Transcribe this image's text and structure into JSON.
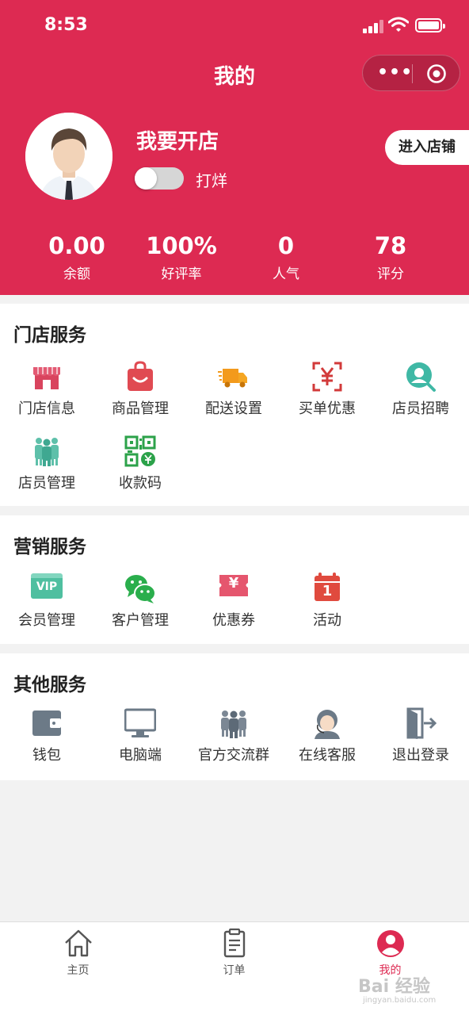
{
  "status_bar": {
    "time": "8:53"
  },
  "header": {
    "title": "我的",
    "capsule_more": "•••",
    "shop_name": "我要开店",
    "toggle_label": "打烊",
    "enter_button": "进入店铺",
    "background_color": "#dd2a52"
  },
  "stats": [
    {
      "value": "0.00",
      "label": "余额"
    },
    {
      "value": "100%",
      "label": "好评率"
    },
    {
      "value": "0",
      "label": "人气"
    },
    {
      "value": "78",
      "label": "评分"
    }
  ],
  "store_services": {
    "title": "门店服务",
    "items": [
      {
        "label": "门店信息",
        "icon": "storefront-icon"
      },
      {
        "label": "商品管理",
        "icon": "shopping-bag-icon"
      },
      {
        "label": "配送设置",
        "icon": "delivery-truck-icon"
      },
      {
        "label": "买单优惠",
        "icon": "scan-yuan-icon"
      },
      {
        "label": "店员招聘",
        "icon": "search-person-icon"
      },
      {
        "label": "店员管理",
        "icon": "staff-group-icon"
      },
      {
        "label": "收款码",
        "icon": "qr-code-icon"
      }
    ]
  },
  "marketing_services": {
    "title": "营销服务",
    "items": [
      {
        "label": "会员管理",
        "icon": "vip-card-icon",
        "icon_text": "VIP"
      },
      {
        "label": "客户管理",
        "icon": "wechat-icon"
      },
      {
        "label": "优惠券",
        "icon": "coupon-icon",
        "icon_text": "¥"
      },
      {
        "label": "活动",
        "icon": "calendar-icon",
        "icon_text": "1"
      }
    ]
  },
  "other_services": {
    "title": "其他服务",
    "items": [
      {
        "label": "钱包",
        "icon": "wallet-icon"
      },
      {
        "label": "电脑端",
        "icon": "monitor-icon"
      },
      {
        "label": "官方交流群",
        "icon": "group-icon"
      },
      {
        "label": "在线客服",
        "icon": "customer-service-icon"
      },
      {
        "label": "退出登录",
        "icon": "logout-icon"
      }
    ]
  },
  "tabbar": [
    {
      "label": "主页",
      "icon": "home-icon",
      "active": false
    },
    {
      "label": "订单",
      "icon": "clipboard-icon",
      "active": false
    },
    {
      "label": "我的",
      "icon": "profile-icon",
      "active": true
    }
  ],
  "watermark": {
    "brand": "Bai 经验",
    "url": "jingyan.baidu.com"
  }
}
